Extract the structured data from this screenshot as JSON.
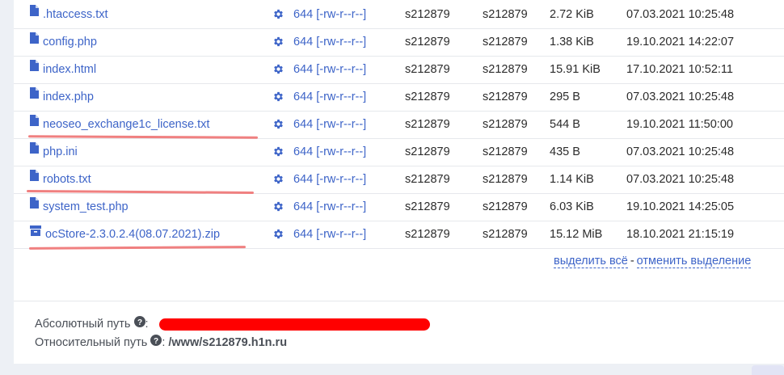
{
  "files": [
    {
      "name": ".htaccess.txt",
      "icon": "file-icon",
      "permissions": "644 [-rw-r--r--]",
      "owner": "s212879",
      "group": "s212879",
      "size": "2.72 KiB",
      "modified": "07.03.2021 10:25:48"
    },
    {
      "name": "config.php",
      "icon": "file-icon",
      "permissions": "644 [-rw-r--r--]",
      "owner": "s212879",
      "group": "s212879",
      "size": "1.38 KiB",
      "modified": "19.10.2021 14:22:07"
    },
    {
      "name": "index.html",
      "icon": "file-icon",
      "permissions": "644 [-rw-r--r--]",
      "owner": "s212879",
      "group": "s212879",
      "size": "15.91 KiB",
      "modified": "17.10.2021 10:52:11"
    },
    {
      "name": "index.php",
      "icon": "file-icon",
      "permissions": "644 [-rw-r--r--]",
      "owner": "s212879",
      "group": "s212879",
      "size": "295 B",
      "modified": "07.03.2021 10:25:48"
    },
    {
      "name": "neoseo_exchange1c_license.txt",
      "icon": "file-icon",
      "permissions": "644 [-rw-r--r--]",
      "owner": "s212879",
      "group": "s212879",
      "size": "544 B",
      "modified": "19.10.2021 11:50:00"
    },
    {
      "name": "php.ini",
      "icon": "file-icon",
      "permissions": "644 [-rw-r--r--]",
      "owner": "s212879",
      "group": "s212879",
      "size": "435 B",
      "modified": "07.03.2021 10:25:48"
    },
    {
      "name": "robots.txt",
      "icon": "file-icon",
      "permissions": "644 [-rw-r--r--]",
      "owner": "s212879",
      "group": "s212879",
      "size": "1.14 KiB",
      "modified": "07.03.2021 10:25:48"
    },
    {
      "name": "system_test.php",
      "icon": "file-icon",
      "permissions": "644 [-rw-r--r--]",
      "owner": "s212879",
      "group": "s212879",
      "size": "6.03 KiB",
      "modified": "19.10.2021 14:25:05"
    },
    {
      "name": "ocStore-2.3.0.2.4(08.07.2021).zip",
      "icon": "archive-icon",
      "permissions": "644 [-rw-r--r--]",
      "owner": "s212879",
      "group": "s212879",
      "size": "15.12 MiB",
      "modified": "18.10.2021 21:15:19"
    }
  ],
  "actions": {
    "select_all": "выделить всё",
    "separator": "-",
    "deselect": "отменить выделение"
  },
  "paths": {
    "absolute_label": "Абсолютный путь",
    "relative_label": "Относительный путь",
    "relative_value": "/www/s212879.h1n.ru"
  },
  "colors": {
    "link": "#3d64c8",
    "underline_mark": "#f08080",
    "redaction": "#ff0000"
  }
}
